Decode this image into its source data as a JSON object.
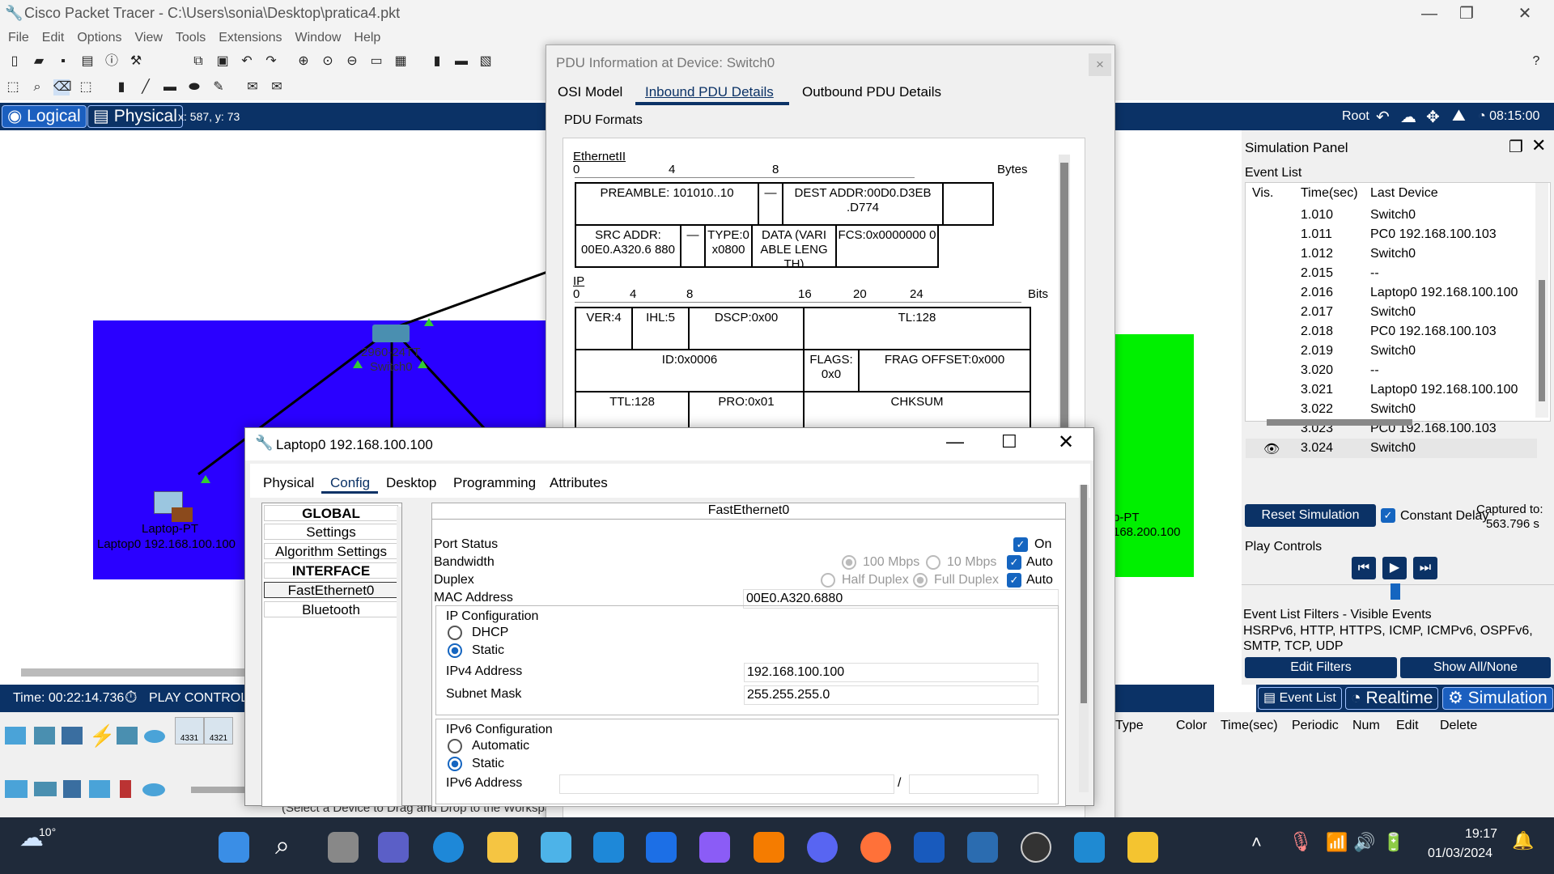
{
  "app": {
    "title": "Cisco Packet Tracer - C:\\Users\\sonia\\Desktop\\pratica4.pkt"
  },
  "menu": [
    "File",
    "Edit",
    "Options",
    "View",
    "Tools",
    "Extensions",
    "Window",
    "Help"
  ],
  "bluebar": {
    "logical": "Logical",
    "physical": "Physical",
    "coords": "x: 587, y: 73",
    "root": "Root",
    "clock": "08:15:00"
  },
  "workspace": {
    "switch_model": "2960-24TT",
    "switch_name": "Switch0",
    "laptop_type": "Laptop-PT",
    "laptop_name": "Laptop0 192.168.100.100",
    "right_type": "p-PT",
    "right_name": "168.200.100"
  },
  "timebar": {
    "time": "Time: 00:22:14.736",
    "play": "PLAY CONTROL"
  },
  "devices": {
    "r1": "4331",
    "r2": "4321",
    "hint": "(Select a Device to Drag and Drop to the Workspace)"
  },
  "pdu": {
    "title": "PDU Information at Device: Switch0",
    "tabs": [
      "OSI Model",
      "Inbound PDU Details",
      "Outbound PDU Details"
    ],
    "formats": "PDU Formats",
    "eth": {
      "label": "EthernetII",
      "scale": [
        "0",
        "4",
        "8"
      ],
      "unit": "Bytes",
      "preamble": "PREAMBLE: 101010..10",
      "dest": "DEST ADDR:00D0.D3EB .D774",
      "src": "SRC ADDR: 00E0.A320.6 880",
      "type": "TYPE:0 x0800",
      "data": "DATA (VARI ABLE LENG TH)",
      "fcs": "FCS:0x0000000 0"
    },
    "ip": {
      "label": "IP",
      "scale": [
        "0",
        "4",
        "8",
        "16",
        "20",
        "24"
      ],
      "unit": "Bits",
      "ver": "VER:4",
      "ihl": "IHL:5",
      "dscp": "DSCP:0x00",
      "tl": "TL:128",
      "id": "ID:0x0006",
      "flags": "FLAGS: 0x0",
      "frag": "FRAG OFFSET:0x000",
      "ttl": "TTL:128",
      "pro": "PRO:0x01",
      "chk": "CHKSUM"
    }
  },
  "laptop": {
    "title": "Laptop0 192.168.100.100",
    "tabs": [
      "Physical",
      "Config",
      "Desktop",
      "Programming",
      "Attributes"
    ],
    "side": [
      "GLOBAL",
      "Settings",
      "Algorithm Settings",
      "INTERFACE",
      "FastEthernet0",
      "Bluetooth"
    ],
    "iface": "FastEthernet0",
    "port_status": "Port Status",
    "on": "On",
    "bandwidth": "Bandwidth",
    "b100": "100 Mbps",
    "b10": "10 Mbps",
    "auto": "Auto",
    "duplex": "Duplex",
    "half": "Half Duplex",
    "full": "Full Duplex",
    "mac_label": "MAC Address",
    "mac": "00E0.A320.6880",
    "ipcfg": "IP Configuration",
    "dhcp": "DHCP",
    "static": "Static",
    "ipv4_label": "IPv4 Address",
    "ipv4": "192.168.100.100",
    "mask_label": "Subnet Mask",
    "mask": "255.255.255.0",
    "ipv6cfg": "IPv6 Configuration",
    "automatic": "Automatic",
    "ipv6_label": "IPv6 Address",
    "slash": "/"
  },
  "sim": {
    "title": "Simulation Panel",
    "eventlist": "Event List",
    "cols": [
      "Vis.",
      "Time(sec)",
      "Last Device"
    ],
    "events": [
      {
        "t": "1.010",
        "d": "Switch0"
      },
      {
        "t": "1.011",
        "d": "PC0 192.168.100.103"
      },
      {
        "t": "1.012",
        "d": "Switch0"
      },
      {
        "t": "2.015",
        "d": "--"
      },
      {
        "t": "2.016",
        "d": "Laptop0 192.168.100.100"
      },
      {
        "t": "2.017",
        "d": "Switch0"
      },
      {
        "t": "2.018",
        "d": "PC0 192.168.100.103"
      },
      {
        "t": "2.019",
        "d": "Switch0"
      },
      {
        "t": "3.020",
        "d": "--"
      },
      {
        "t": "3.021",
        "d": "Laptop0 192.168.100.100"
      },
      {
        "t": "3.022",
        "d": "Switch0"
      },
      {
        "t": "3.023",
        "d": "PC0 192.168.100.103"
      },
      {
        "t": "3.024",
        "d": "Switch0"
      }
    ],
    "reset": "Reset Simulation",
    "constant": "Constant Delay",
    "captured_label": "Captured to:",
    "captured": "563.796 s",
    "play": "Play Controls",
    "filters_title": "Event List Filters - Visible Events",
    "filters": "HSRPv6, HTTP, HTTPS, ICMP, ICMPv6, OSPFv6, SMTP, TCP, UDP",
    "edit": "Edit Filters",
    "show": "Show All/None",
    "eventlist_btn": "Event List",
    "realtime": "Realtime",
    "simulation": "Simulation",
    "pdu_cols": [
      "Type",
      "Color",
      "Time(sec)",
      "Periodic",
      "Num",
      "Edit",
      "Delete"
    ]
  },
  "taskbar": {
    "temp": "10°",
    "time": "19:17",
    "date": "01/03/2024"
  }
}
